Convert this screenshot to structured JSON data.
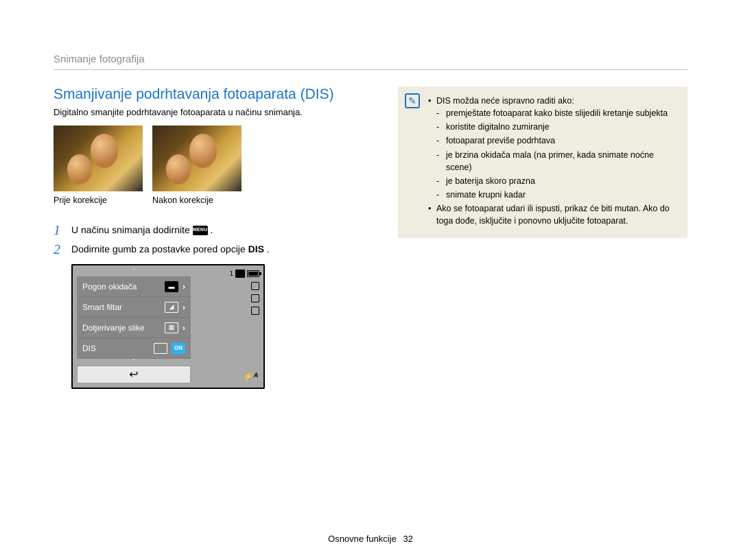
{
  "breadcrumb": "Snimanje fotografija",
  "title": "Smanjivanje podrhtavanja fotoaparata (DIS)",
  "intro": "Digitalno smanjite podrhtavanje fotoaparata u načinu snimanja.",
  "captions": {
    "before": "Prije korekcije",
    "after": "Nakon korekcije"
  },
  "steps": {
    "s1_a": "U načinu snimanja dodirnite ",
    "s1_menu": "MENU",
    "s1_b": " .",
    "s2_a": "Dodirnite gumb za postavke pored opcije ",
    "s2_bold": "DIS",
    "s2_b": "."
  },
  "screen": {
    "rows": {
      "r1": "Pogon okidača",
      "r2": "Smart filtar",
      "r3": "Dotjerivanje slike",
      "r4": "DIS"
    },
    "on": "ON",
    "back": "↩",
    "count": "1",
    "flash": "⚡ᴬ",
    "scroll_up": "ˆ",
    "scroll_dn": "ˇ"
  },
  "note": {
    "icon": "✎",
    "b1": "DIS možda neće ispravno raditi ako:",
    "b1_1": "premještate fotoaparat kako biste slijedili kretanje subjekta",
    "b1_2": "koristite digitalno zumiranje",
    "b1_3": "fotoaparat previše podrhtava",
    "b1_4": "je brzina okidača mala (na primer, kada snimate noćne scene)",
    "b1_5": "je baterija skoro prazna",
    "b1_6": "snimate krupni kadar",
    "b2": "Ako se fotoaparat udari ili ispusti, prikaz će biti mutan. Ako do toga dođe, isključite i ponovno uključite fotoaparat."
  },
  "footer": {
    "label": "Osnovne funkcije",
    "page": "32"
  }
}
